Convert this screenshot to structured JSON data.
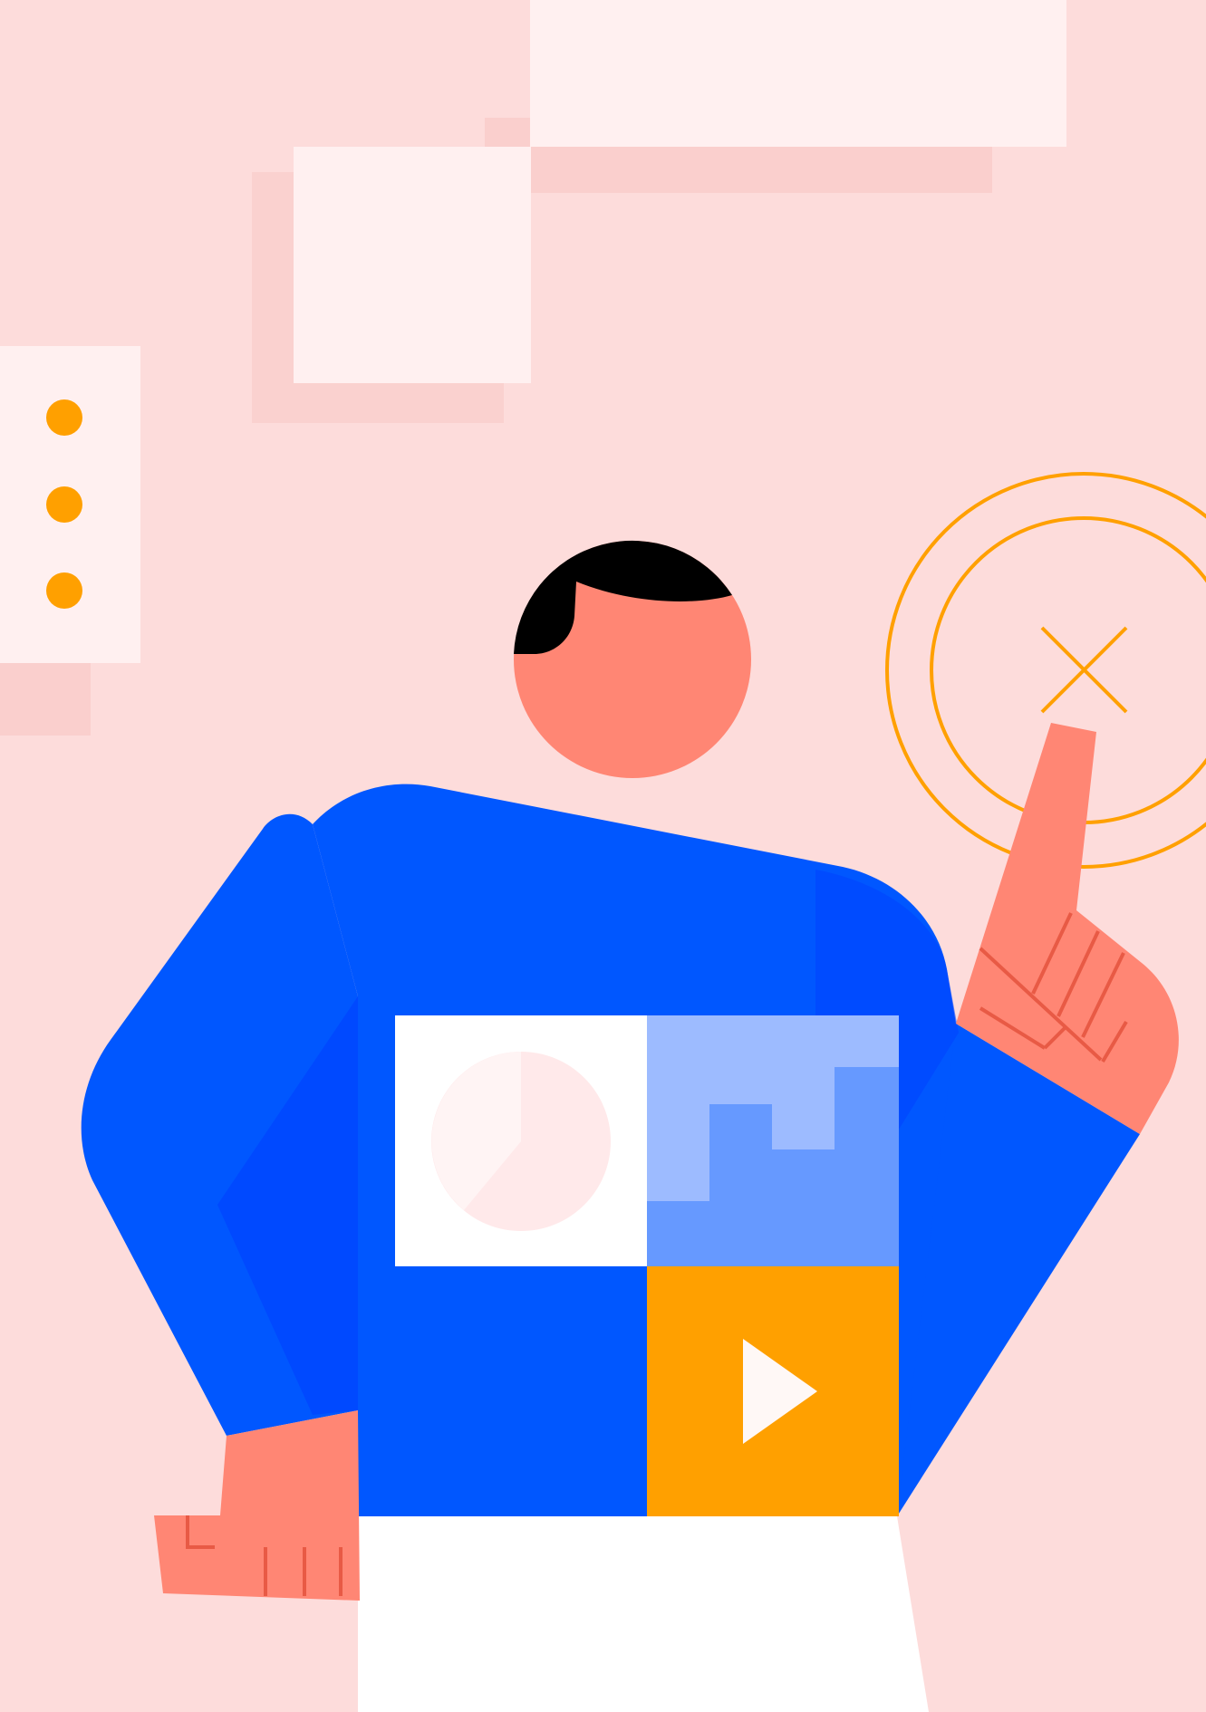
{
  "colors": {
    "background": "#FDDCDB",
    "panel_light": "#FFF0F0",
    "panel_shadow": "#F8C9C7",
    "accent_orange": "#FFA000",
    "sweater_blue": "#0057FF",
    "sweater_shadow": "#0043FF",
    "skin": "#FF8674",
    "skin_line": "#E85A45",
    "hair": "#000000",
    "pants": "#FFFFFF",
    "tile_light_blue": "#9DBBFF",
    "tile_mid_blue": "#6699FF",
    "pie_fill": "#FFE9EA",
    "play_triangle": "#FFF8F6"
  },
  "icons": {
    "menu_dots": "vertical-ellipsis-icon",
    "close": "close-icon",
    "pie_chart": "pie-chart-icon",
    "bar_chart": "step-chart-icon",
    "play": "play-icon"
  }
}
